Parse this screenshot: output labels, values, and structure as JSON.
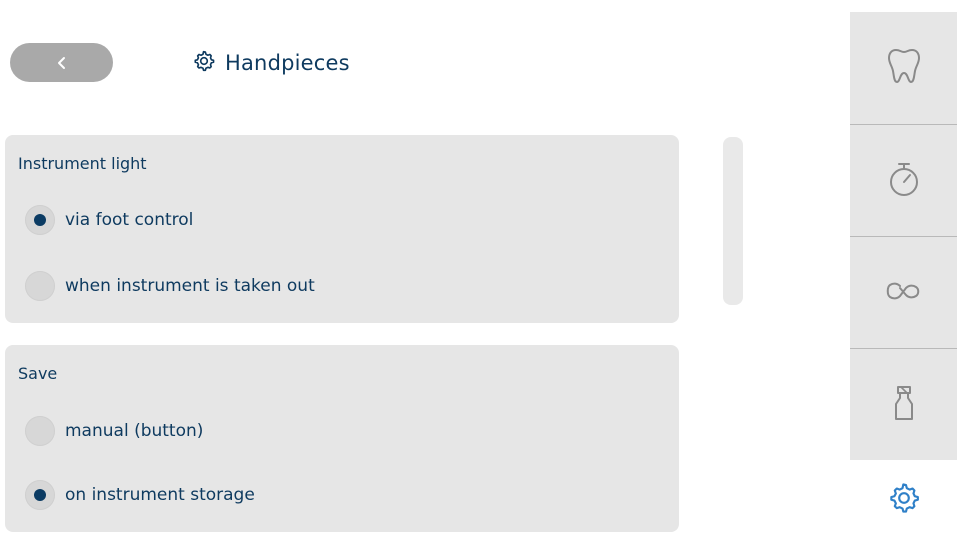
{
  "header": {
    "back_icon": "chevron-left-icon",
    "title_icon": "gear-icon",
    "title": "Handpieces"
  },
  "instrument_light": {
    "title": "Instrument light",
    "options": [
      {
        "label": "via foot control",
        "selected": true
      },
      {
        "label": "when instrument is taken out",
        "selected": false
      }
    ]
  },
  "save": {
    "title": "Save",
    "options": [
      {
        "label": "manual (button)",
        "selected": false
      },
      {
        "label": "on instrument storage",
        "selected": true
      }
    ]
  },
  "nav": {
    "items": [
      {
        "icon": "tooth-icon"
      },
      {
        "icon": "stopwatch-icon"
      },
      {
        "icon": "infinity-icon"
      },
      {
        "icon": "spray-bottle-icon"
      }
    ],
    "settings_icon": "gear-icon",
    "active": "settings"
  },
  "colors": {
    "accent": "#2f80c8",
    "text": "#0e3a5f",
    "panel": "#e6e6e6",
    "radio_selected": "#0b3b63",
    "icon_inactive": "#8a8a8a"
  }
}
